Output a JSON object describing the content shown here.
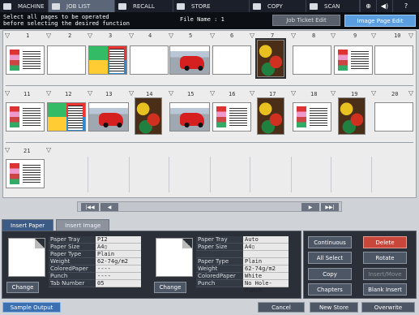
{
  "nav": {
    "tabs": [
      {
        "label": "MACHINE",
        "icon": "machine-icon"
      },
      {
        "label": "JOB LIST",
        "icon": "job-list-icon"
      },
      {
        "label": "RECALL",
        "icon": "recall-icon"
      },
      {
        "label": "STORE",
        "icon": "store-icon"
      },
      {
        "label": "COPY",
        "icon": "copy-icon"
      },
      {
        "label": "SCAN",
        "icon": "scan-icon"
      }
    ],
    "globe_icon": "globe-icon",
    "sound_icon": "speaker-icon",
    "help_label": "?"
  },
  "header": {
    "instruction_line1": "Select all pages to be operated",
    "instruction_line2": "before selecting the desired function",
    "file_name": "File Name : 1",
    "job_ticket_edit": "Job Ticket Edit",
    "image_page_edit": "Image Page Edit"
  },
  "pages": {
    "row1": [
      "1",
      "2",
      "3",
      "4",
      "5",
      "6",
      "7",
      "8",
      "9",
      "10"
    ],
    "row2": [
      "11",
      "12",
      "13",
      "14",
      "15",
      "16",
      "17",
      "18",
      "19",
      "20"
    ],
    "row3": [
      "21"
    ]
  },
  "scroll": {
    "first": "|◀◀",
    "prev": "◀",
    "next": "▶",
    "last": "▶▶|"
  },
  "tabs": {
    "insert_paper": "Insert Paper",
    "insert_image": "Insert Image"
  },
  "left_paper": {
    "change_label": "Change",
    "rows": [
      {
        "label": "Paper Tray",
        "value": "PI2"
      },
      {
        "label": "Paper Size",
        "value": "A4▯"
      },
      {
        "label": "Paper Type",
        "value": "Plain"
      },
      {
        "label": "Weight",
        "value": "62-74g/m2"
      },
      {
        "label": "ColoredPaper",
        "value": "----"
      },
      {
        "label": "Punch",
        "value": "----"
      },
      {
        "label": "Tab Number",
        "value": "05"
      }
    ]
  },
  "right_paper": {
    "change_label": "Change",
    "rows": [
      {
        "label": "Paper Tray",
        "value": "Auto"
      },
      {
        "label": "Paper Size",
        "value": "A4▯"
      },
      {
        "label": "",
        "value": ""
      },
      {
        "label": "Paper Type",
        "value": "Plain"
      },
      {
        "label": "Weight",
        "value": "62-74g/m2"
      },
      {
        "label": "ColoredPaper",
        "value": "White"
      },
      {
        "label": "Punch",
        "value": "No Hole-Punch"
      }
    ]
  },
  "actions": {
    "continuous": "Continuous",
    "delete": "Delete",
    "all_select": "All Select",
    "rotate": "Rotate",
    "copy": "Copy",
    "insert_move": "Insert/Move",
    "chapters": "Chapters",
    "blank_insert": "Blank Insert"
  },
  "footer": {
    "sample_output": "Sample Output",
    "cancel": "Cancel",
    "new_store": "New Store",
    "overwrite": "Overwrite"
  }
}
